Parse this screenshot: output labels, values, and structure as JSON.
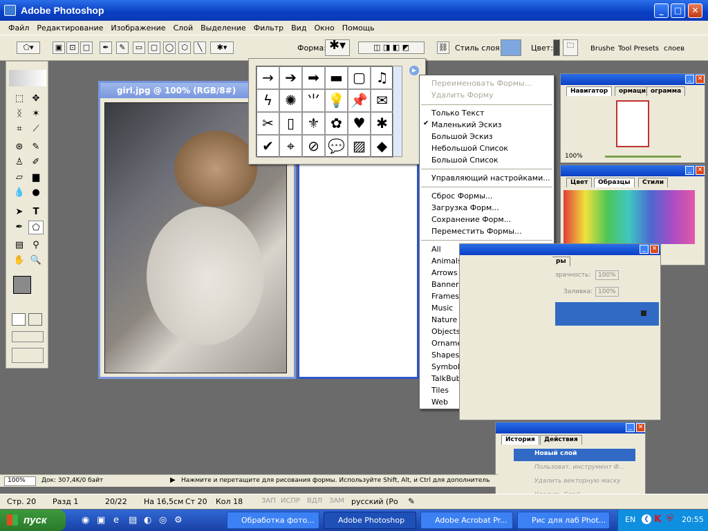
{
  "app": {
    "title": "Adobe Photoshop"
  },
  "menu": [
    "Файл",
    "Редактирование",
    "Изображение",
    "Слой",
    "Выделение",
    "Фильтр",
    "Вид",
    "Окно",
    "Помощь"
  ],
  "options": {
    "shape_label": "Форма:",
    "style_label": "Стиль слоя:",
    "color_label": "Цвет:",
    "palette_tabs": [
      "Brushe",
      "Tool Presets",
      "слоев"
    ]
  },
  "document": {
    "title": "girl.jpg @ 100% (RGB/8#)"
  },
  "context_menu": {
    "group1": [
      {
        "label": "Переименовать Формы...",
        "disabled": true
      },
      {
        "label": "Удалить Форму",
        "disabled": true
      }
    ],
    "group2": [
      {
        "label": "Только Текст",
        "checked": false
      },
      {
        "label": "Маленький Эскиз",
        "checked": true
      },
      {
        "label": "Большой Эскиз",
        "checked": false
      },
      {
        "label": "Небольшой Список",
        "checked": false
      },
      {
        "label": "Большой Список",
        "checked": false
      }
    ],
    "group3": [
      {
        "label": "Управляющий настройками..."
      }
    ],
    "group4": [
      {
        "label": "Сброс Формы..."
      },
      {
        "label": "Загрузка Форм..."
      },
      {
        "label": "Сохранение Форм..."
      },
      {
        "label": "Переместить Формы..."
      }
    ],
    "group5": [
      "All",
      "Animals",
      "Arrows",
      "Banners",
      "Frames",
      "Music",
      "Nature",
      "Objects",
      "Ornaments",
      "Shapes",
      "Symbols",
      "TalkBubbles",
      "Tiles",
      "Web"
    ]
  },
  "navigator": {
    "tabs": [
      "Навигатор",
      "ормация",
      "ограмма"
    ],
    "zoom": "100%"
  },
  "swatches": {
    "tabs": [
      "Цвет",
      "Образцы",
      "Стили"
    ]
  },
  "layers": {
    "tab_partial": "ры",
    "opacity_label": "зрачность:",
    "opacity": "100%",
    "fill_label": "Заливка:",
    "fill": "100%"
  },
  "history": {
    "tabs": [
      "История",
      "Действия"
    ],
    "items": [
      {
        "label": "Новый слой",
        "active": true
      },
      {
        "label": "Пользоват. инструмент Ф...",
        "active": false
      },
      {
        "label": "Удалить векторную маску",
        "active": false
      },
      {
        "label": "Удалить Слой",
        "active": false
      }
    ]
  },
  "status": {
    "zoom": "100%",
    "doc": "Док: 307,4K/0 байт",
    "hint": "Нажмите и перетащите для рисования формы. Используйте Shift, Alt, и Ctrl для дополнитель"
  },
  "word_status": {
    "page": "Стр. 20",
    "section": "Разд 1",
    "pages": "20/22",
    "pos": "На 16,5см",
    "line": "Ст 20",
    "col": "Кол 18",
    "rec": "ЗАП",
    "trk": "ИСПР",
    "ext": "ВДЛ",
    "ovr": "ЗАМ",
    "lang": "русский (Ро"
  },
  "taskbar": {
    "start": "пуск",
    "tasks": [
      "Обработка фото...",
      "Adobe Photoshop",
      "Adobe Acrobat Pr...",
      "Рис для лаб Phot..."
    ],
    "lang": "EN",
    "time": "20:55"
  }
}
